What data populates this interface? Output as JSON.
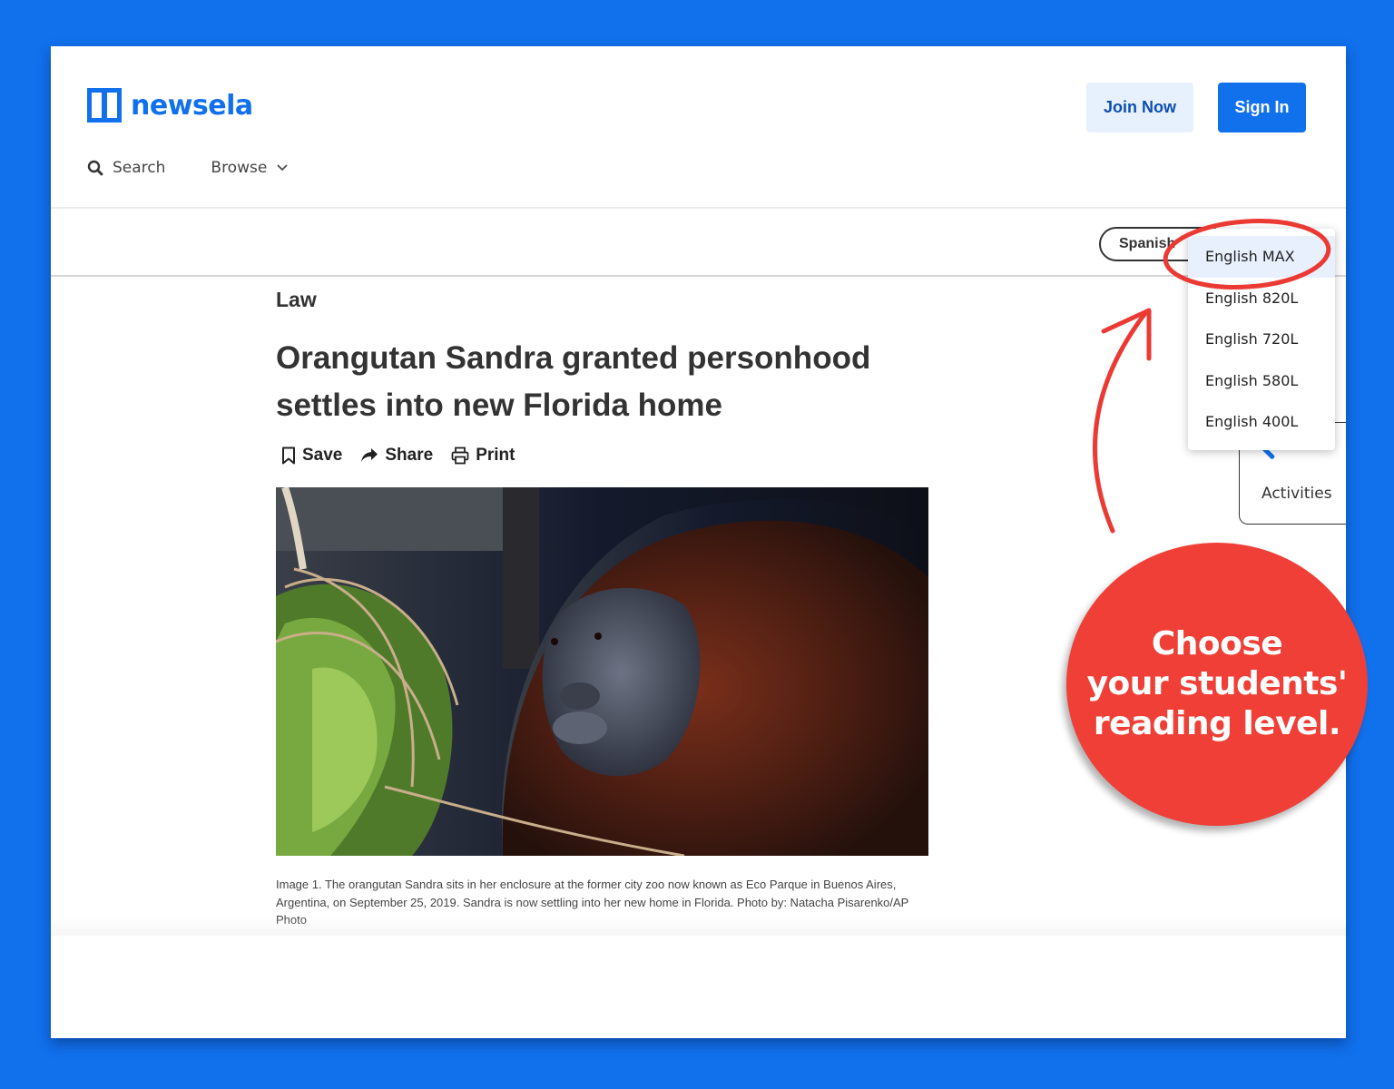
{
  "header": {
    "logo_text": "newsela",
    "join_label": "Join Now",
    "signin_label": "Sign In",
    "nav": {
      "search_label": "Search",
      "browse_label": "Browse"
    }
  },
  "language_selector": {
    "current": "Spanish",
    "options": [
      "English MAX",
      "English 820L",
      "English 720L",
      "English 580L",
      "English 400L"
    ],
    "selected": "English MAX"
  },
  "side_panel": {
    "activities_label": "Activities"
  },
  "article": {
    "category": "Law",
    "title": "Orangutan Sandra granted personhood settles into new Florida home",
    "actions": {
      "save": "Save",
      "share": "Share",
      "print": "Print"
    },
    "image_alt": "Orangutan Sandra in her enclosure",
    "caption": "Image 1. The orangutan Sandra sits in her enclosure at the former city zoo now known as Eco Parque in Buenos Aires, Argentina, on September 25, 2019. Sandra is now settling into her new home in Florida. Photo by: Natacha Pisarenko/AP Photo"
  },
  "callout": {
    "line1": "Choose",
    "line2": "your students'",
    "line3": "reading level."
  },
  "colors": {
    "brand_blue": "#1170ec",
    "annotation_red": "#ef3f36",
    "join_bg": "#e7f0fd"
  }
}
